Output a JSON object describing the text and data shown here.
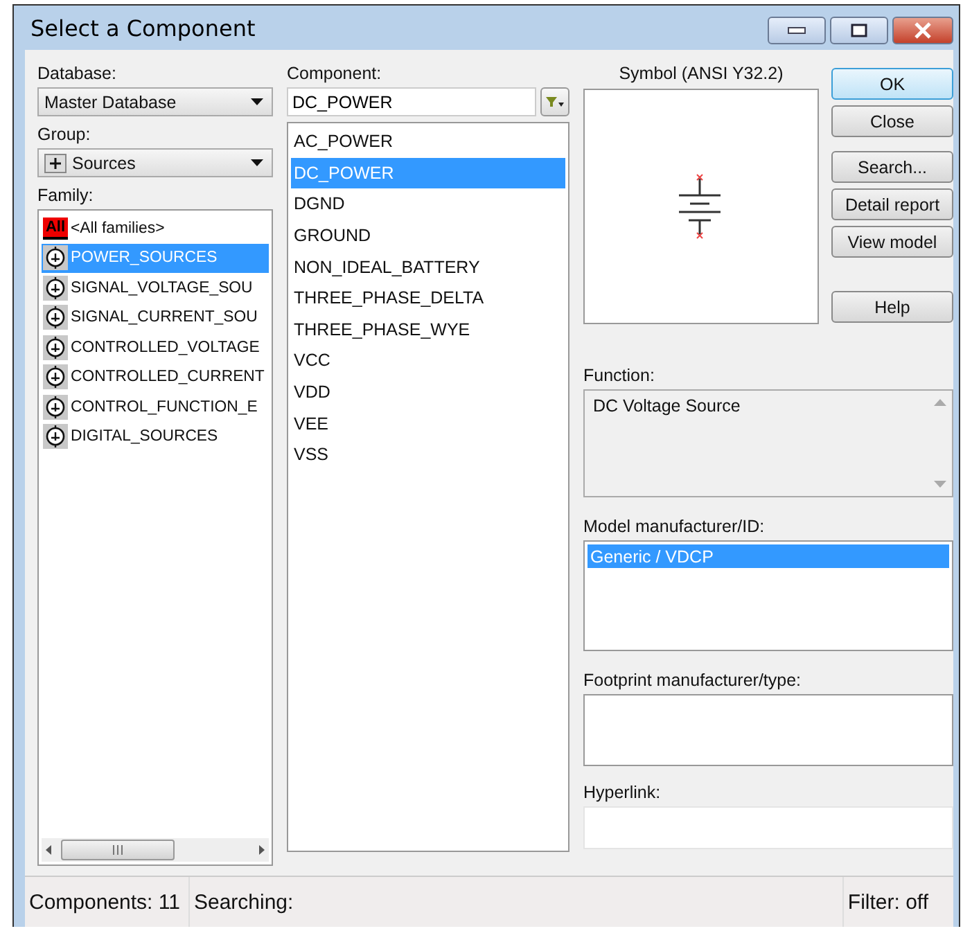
{
  "window": {
    "title": "Select a Component"
  },
  "database": {
    "label": "Database:",
    "value": "Master Database"
  },
  "group": {
    "label": "Group:",
    "value": "Sources"
  },
  "family": {
    "label": "Family:",
    "items": [
      {
        "kind": "all",
        "badge": "All",
        "label": "<All families>",
        "selected": false
      },
      {
        "kind": "symbol",
        "label": "POWER_SOURCES",
        "selected": true
      },
      {
        "kind": "symbol",
        "label": "SIGNAL_VOLTAGE_SOU",
        "selected": false
      },
      {
        "kind": "symbol",
        "label": "SIGNAL_CURRENT_SOU",
        "selected": false
      },
      {
        "kind": "symbol",
        "label": "CONTROLLED_VOLTAGE",
        "selected": false
      },
      {
        "kind": "symbol",
        "label": "CONTROLLED_CURRENT",
        "selected": false
      },
      {
        "kind": "symbol",
        "label": "CONTROL_FUNCTION_E",
        "selected": false
      },
      {
        "kind": "symbol",
        "label": "DIGITAL_SOURCES",
        "selected": false
      }
    ]
  },
  "component": {
    "label": "Component:",
    "value": "DC_POWER",
    "items": [
      {
        "label": "AC_POWER",
        "selected": false
      },
      {
        "label": "DC_POWER",
        "selected": true
      },
      {
        "label": "DGND",
        "selected": false
      },
      {
        "label": "GROUND",
        "selected": false
      },
      {
        "label": "NON_IDEAL_BATTERY",
        "selected": false
      },
      {
        "label": "THREE_PHASE_DELTA",
        "selected": false
      },
      {
        "label": "THREE_PHASE_WYE",
        "selected": false
      },
      {
        "label": "VCC",
        "selected": false
      },
      {
        "label": "VDD",
        "selected": false
      },
      {
        "label": "VEE",
        "selected": false
      },
      {
        "label": "VSS",
        "selected": false
      }
    ]
  },
  "symbol": {
    "label": "Symbol (ANSI Y32.2)"
  },
  "buttons": [
    {
      "label": "OK",
      "default": true
    },
    {
      "label": "Close",
      "default": false
    },
    {
      "label": "Search...",
      "default": false
    },
    {
      "label": "Detail report",
      "default": false
    },
    {
      "label": "View model",
      "default": false
    },
    {
      "label": "Help",
      "default": false
    }
  ],
  "function": {
    "label": "Function:",
    "value": "DC Voltage Source"
  },
  "model": {
    "label": "Model manufacturer/ID:",
    "items": [
      {
        "label": "Generic / VDCP",
        "selected": true
      }
    ]
  },
  "footprint": {
    "label": "Footprint manufacturer/type:"
  },
  "hyperlink": {
    "label": "Hyperlink:"
  },
  "status_bar": {
    "components": "Components: 11",
    "searching": "Searching:",
    "filter": "Filter: off"
  }
}
